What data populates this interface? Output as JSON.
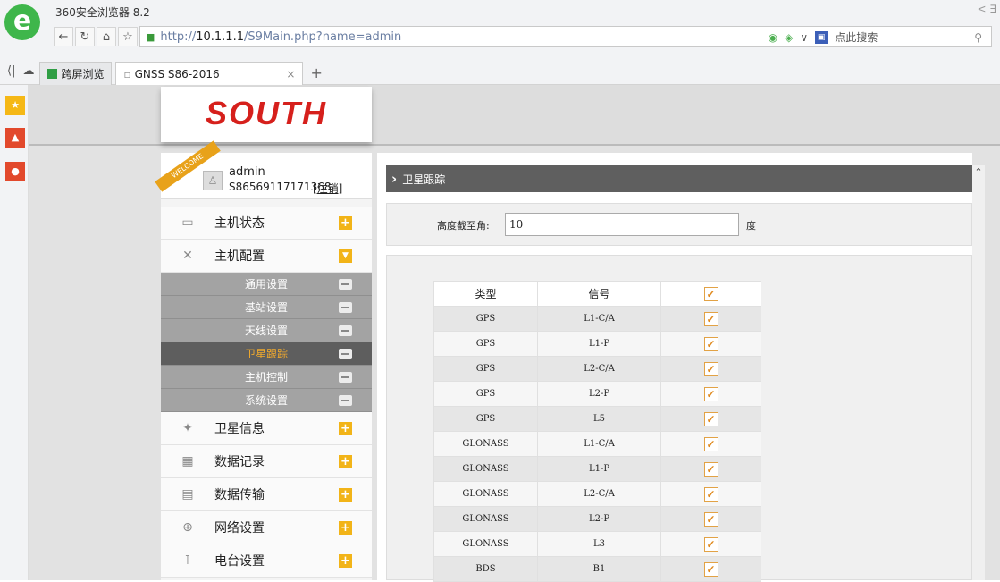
{
  "browser": {
    "title": "360安全浏览器 8.2",
    "logo_glyph": "e",
    "win_hint": "< ∃",
    "url_scheme": "http://",
    "url_host": "10.1.1.1",
    "url_path": "/S9Main.php?name=admin",
    "search_placeholder": "点此搜索",
    "tabs": [
      {
        "label": "跨屏浏览"
      },
      {
        "label": "GNSS S86-2016"
      }
    ]
  },
  "header": {
    "brand": "SOUTH"
  },
  "user": {
    "welcome": "WELCOME",
    "name": "admin",
    "id": "S86569117171368",
    "logout": "[注销]"
  },
  "menu": {
    "top": [
      {
        "label": "主机状态",
        "icon": "monitor-icon"
      },
      {
        "label": "主机配置",
        "icon": "tools-icon"
      }
    ],
    "sub": [
      {
        "label": "通用设置"
      },
      {
        "label": "基站设置"
      },
      {
        "label": "天线设置"
      },
      {
        "label": "卫星跟踪"
      },
      {
        "label": "主机控制"
      },
      {
        "label": "系统设置"
      }
    ],
    "bottom": [
      {
        "label": "卫星信息",
        "icon": "satellite-icon"
      },
      {
        "label": "数据记录",
        "icon": "calendar-icon"
      },
      {
        "label": "数据传输",
        "icon": "network-icon"
      },
      {
        "label": "网络设置",
        "icon": "globe-icon"
      },
      {
        "label": "电台设置",
        "icon": "radio-icon"
      }
    ]
  },
  "section": {
    "title": "卫星跟踪"
  },
  "cutoff": {
    "label": "高度截至角:",
    "value": "10",
    "unit": "度"
  },
  "table": {
    "headers": [
      "类型",
      "信号"
    ],
    "rows": [
      {
        "type": "GPS",
        "signal": "L1-C/A",
        "checked": true
      },
      {
        "type": "GPS",
        "signal": "L1-P",
        "checked": true
      },
      {
        "type": "GPS",
        "signal": "L2-C/A",
        "checked": true
      },
      {
        "type": "GPS",
        "signal": "L2-P",
        "checked": true
      },
      {
        "type": "GPS",
        "signal": "L5",
        "checked": true
      },
      {
        "type": "GLONASS",
        "signal": "L1-C/A",
        "checked": true
      },
      {
        "type": "GLONASS",
        "signal": "L1-P",
        "checked": true
      },
      {
        "type": "GLONASS",
        "signal": "L2-C/A",
        "checked": true
      },
      {
        "type": "GLONASS",
        "signal": "L2-P",
        "checked": true
      },
      {
        "type": "GLONASS",
        "signal": "L3",
        "checked": true
      },
      {
        "type": "BDS",
        "signal": "B1",
        "checked": true
      }
    ]
  }
}
